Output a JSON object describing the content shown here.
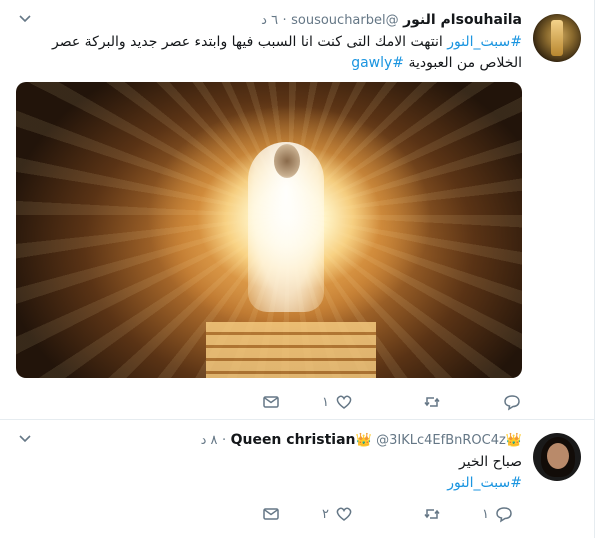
{
  "tweets": [
    {
      "name": "souhailaام النور",
      "handle": "@sousoucharbel",
      "dot": "·",
      "time": "٦ د",
      "text_hashtag_1": "#سبت_النور",
      "text_body": " انتهت الامك التى كنت انا السبب فيها وابتدء عصر جديد والبركة عصر الخلاص من العبودية ",
      "text_hashtag_2": "#gawly",
      "actions": {
        "reply_count": "",
        "retweet_count": "",
        "like_count": "١"
      }
    },
    {
      "name_prefix_crown": "👑",
      "name": "Queen christian",
      "name_suffix_crown": "👑",
      "handle": "@3IKLc4EfBnROC4z",
      "dot": "·",
      "time": "٨ د",
      "text_line_1": "صباح الخير",
      "text_hashtag_1": "#سبت_النور",
      "actions": {
        "reply_count": "١",
        "retweet_count": "",
        "like_count": "٢"
      }
    }
  ],
  "colors": {
    "accent": "#1b95e0",
    "text": "#14171a",
    "muted": "#657786",
    "border": "#e6ecf0"
  },
  "icons": [
    "caret-down-icon",
    "reply-icon",
    "retweet-icon",
    "like-icon",
    "message-icon"
  ]
}
